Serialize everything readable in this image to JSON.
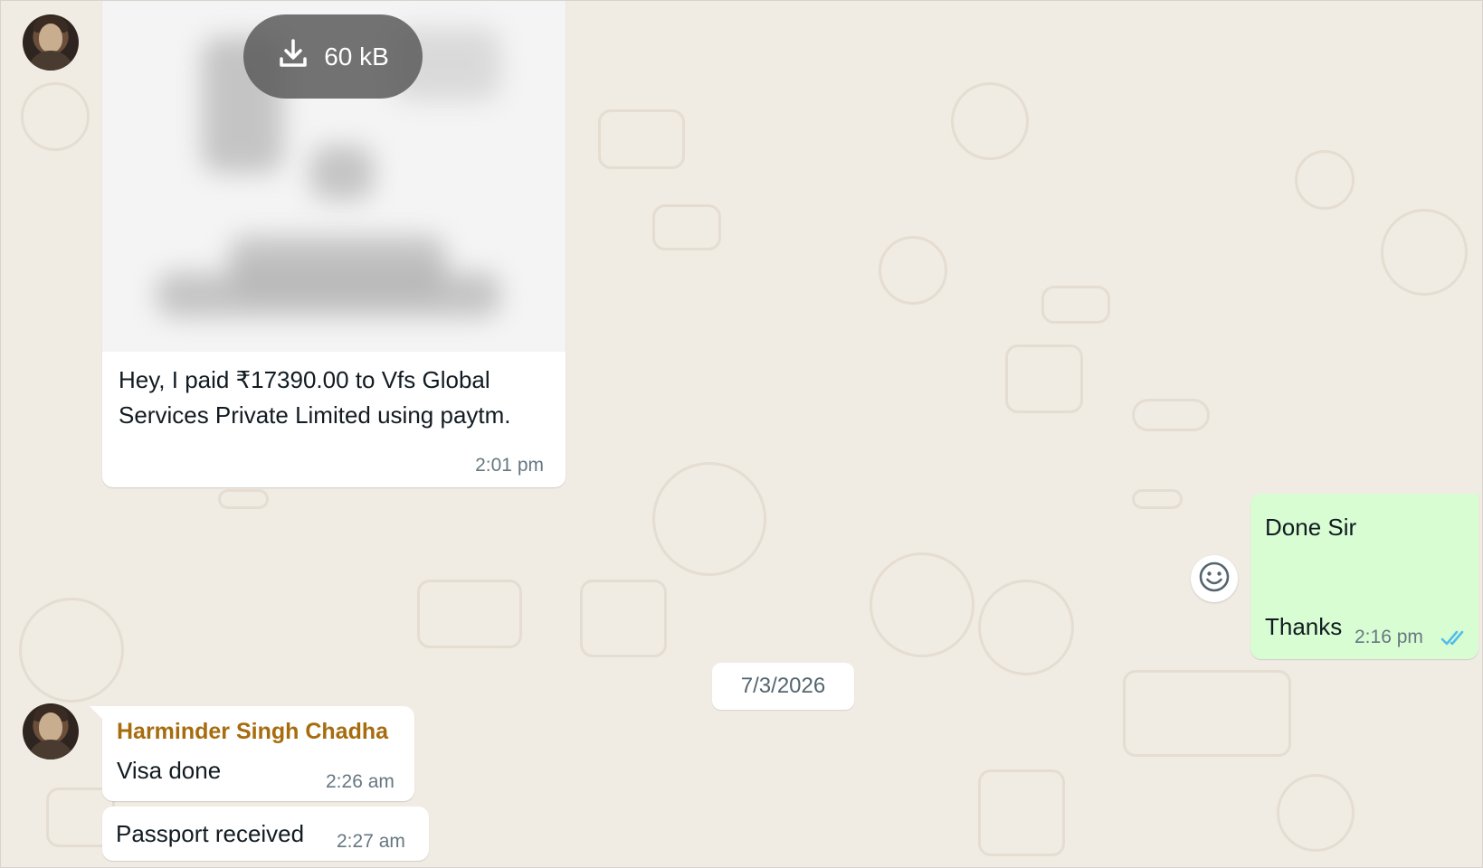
{
  "chat": {
    "date_separator": "7/3/2026",
    "messages": {
      "image_message": {
        "download_size": "60 kB",
        "caption": "Hey, I paid ₹17390.00 to Vfs Global Services Private Limited using paytm.",
        "time": "2:01 pm"
      },
      "outgoing": {
        "line1": "Done Sir",
        "line2": "Thanks",
        "time": "2:16 pm",
        "status_icon": "double-check-icon",
        "status_color": "#53bdeb"
      },
      "incoming_1": {
        "sender": "Harminder Singh Chadha",
        "text": "Visa done",
        "time": "2:26 am"
      },
      "incoming_2": {
        "text": "Passport received",
        "time": "2:27 am"
      }
    }
  },
  "colors": {
    "incoming_bubble": "#ffffff",
    "outgoing_bubble": "#d9fdd3",
    "sender_name": "#a66c0e",
    "wallpaper": "#f0ebe3"
  },
  "icons": {
    "download": "download-icon",
    "emoji": "emoji-icon",
    "avatar": "avatar"
  }
}
